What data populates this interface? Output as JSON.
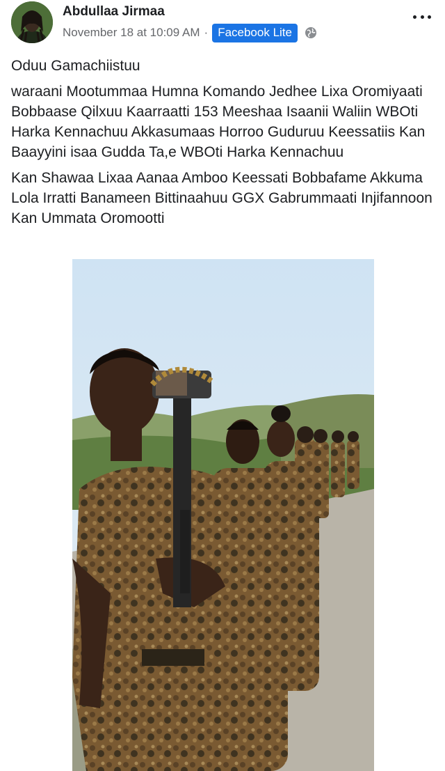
{
  "post": {
    "author": "Abdullaa Jirmaa",
    "timestamp": "November 18 at 10:09 AM",
    "separator": "·",
    "source": "Facebook Lite",
    "paragraphs": [
      "Oduu Gamachiistuu",
      "waraani Mootummaa Humna Komando Jedhee Lixa Oromiyaati Bobbaase Qilxuu Kaarraatti 153 Meeshaa Isaanii Waliin WBOti Harka Kennachuu Akkasumaas Horroo Guduruu Keessatiis Kan Baayyini isaa Gudda Ta,e WBOti Harka Kennachuu",
      "Kan Shawaa Lixaa Aanaa Amboo Keessati Bobbafame Akkuma Lola Irratti Banameen Bittinaahuu GGX Gabrummaati Injifannoon Kan Ummata Oromootti"
    ]
  },
  "icons": {
    "privacy": "globe-icon",
    "menu": "more-options-icon"
  },
  "colors": {
    "badge": "#1b74e4",
    "meta_text": "#65676b"
  }
}
